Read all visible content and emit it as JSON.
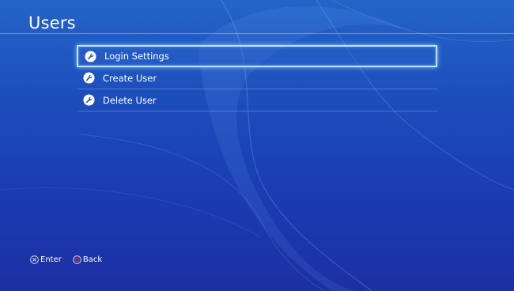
{
  "header": {
    "title": "Users"
  },
  "menu": {
    "items": [
      {
        "label": "Login Settings",
        "icon": "wrench-icon",
        "selected": true
      },
      {
        "label": "Create User",
        "icon": "wrench-icon",
        "selected": false
      },
      {
        "label": "Delete User",
        "icon": "wrench-icon",
        "selected": false
      }
    ]
  },
  "footer": {
    "enter_label": "Enter",
    "enter_icon": "cross-button-icon",
    "back_label": "Back",
    "back_icon": "circle-button-icon"
  },
  "colors": {
    "background_top": "#2464c8",
    "background_bottom": "#1c2fa3",
    "selection_border": "#bfe3ff",
    "back_button": "#d9352f"
  }
}
